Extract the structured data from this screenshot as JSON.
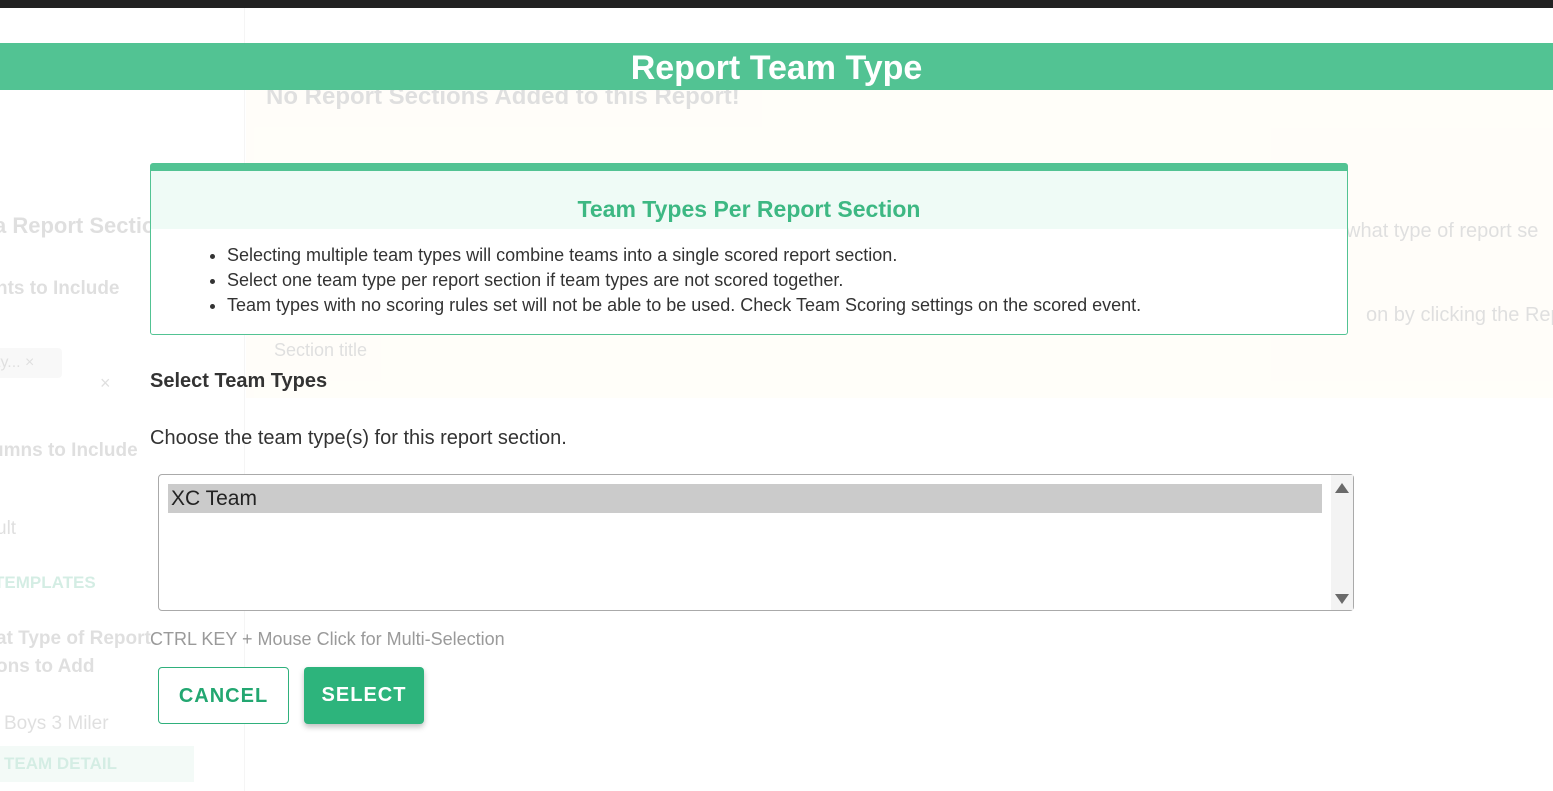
{
  "background": {
    "sidebar": {
      "section_title": "a Report Section",
      "events_heading": "nts to Include",
      "chip_text": "ty...",
      "chip_close": "×",
      "clear_icon": "×",
      "columns_heading": "umns to Include",
      "default_value": "ult",
      "templates_link": "TEMPLATES",
      "type_heading": "at Type of Report\nons to Add",
      "event_name": "Boys 3 Miler",
      "team_detail_button": "TEAM DETAIL"
    },
    "main": {
      "empty_message": "No Report Sections Added to this Report!",
      "right_text_1": "what type of report se",
      "right_text_2": "on by clicking the Rep",
      "section_title_placeholder": "Section title"
    }
  },
  "modal": {
    "title": "Report Team Type",
    "info": {
      "heading": "Team Types Per Report Section",
      "bullets": [
        "Selecting multiple team types will combine teams into a single scored report section.",
        "Select one team type per report section if team types are not scored together.",
        "Team types with no scoring rules set will not be able to be used. Check Team Scoring settings on the scored event."
      ]
    },
    "select_label": "Select Team Types",
    "select_help": "Choose the team type(s) for this report section.",
    "options": [
      "XC Team"
    ],
    "hint": "CTRL KEY + Mouse Click for Multi-Selection",
    "cancel_label": "CANCEL",
    "select_button_label": "SELECT"
  },
  "colors": {
    "accent": "#52c393",
    "button_primary": "#2db47c",
    "selected_option": "#cbcbcb"
  }
}
